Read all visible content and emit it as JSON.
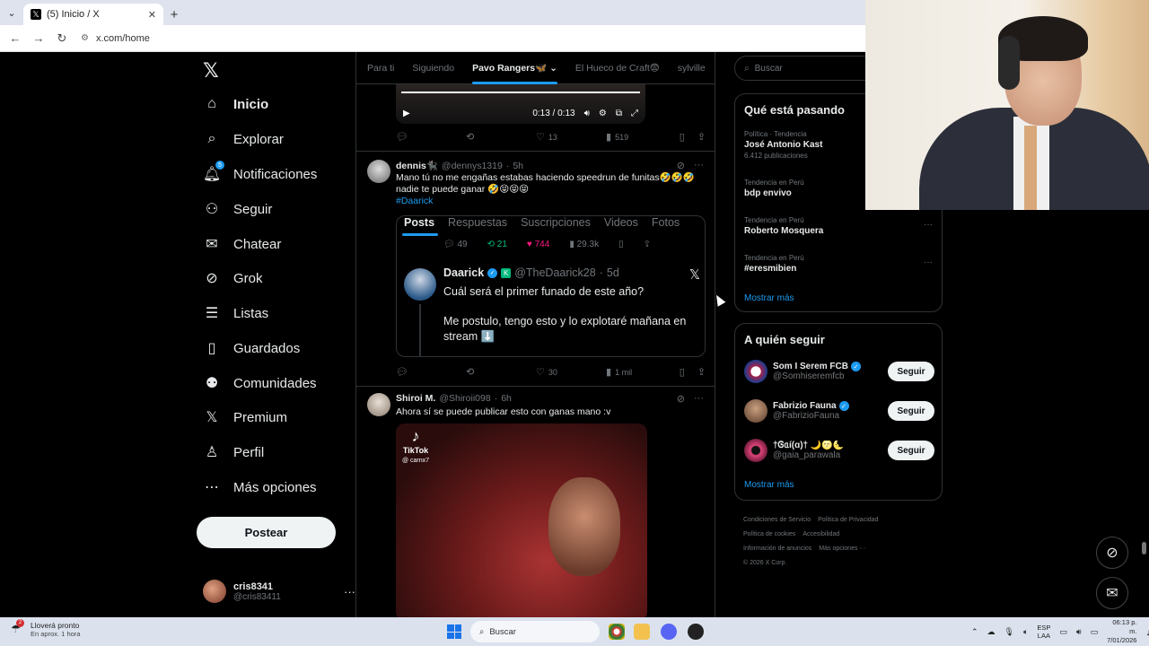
{
  "browser": {
    "tab_title": "(5) Inicio / X",
    "url": "x.com/home"
  },
  "nav": {
    "items": [
      {
        "label": "Inicio",
        "icon": "home-icon"
      },
      {
        "label": "Explorar",
        "icon": "search-icon"
      },
      {
        "label": "Notificaciones",
        "icon": "bell-icon",
        "badge": "5"
      },
      {
        "label": "Seguir",
        "icon": "add-person-icon"
      },
      {
        "label": "Chatear",
        "icon": "mail-icon"
      },
      {
        "label": "Grok",
        "icon": "grok-icon"
      },
      {
        "label": "Listas",
        "icon": "list-icon"
      },
      {
        "label": "Guardados",
        "icon": "bookmark-icon"
      },
      {
        "label": "Comunidades",
        "icon": "communities-icon"
      },
      {
        "label": "Premium",
        "icon": "x-logo-icon"
      },
      {
        "label": "Perfil",
        "icon": "person-icon"
      },
      {
        "label": "Más opciones",
        "icon": "more-circle-icon"
      }
    ],
    "post_label": "Postear",
    "account": {
      "display_name": "cris8341",
      "handle": "@cris83411"
    }
  },
  "timeline": {
    "tabs": [
      "Para ti",
      "Siguiendo",
      "Pavo Rangers🦋",
      "El Hueco de Craft😨",
      "sylville"
    ],
    "selected_tab": "Pavo Rangers🦋",
    "top_video": {
      "time": "0:13 / 0:13"
    },
    "top_actions": {
      "replies": "",
      "reposts": "",
      "likes": "13",
      "views": "519"
    },
    "tweet1": {
      "name": "dennis🐈‍⬛",
      "handle": "@dennys1319",
      "time": "5h",
      "text": "Mano tú no me engañas estabas haciendo speedrun de funitas🤣🤣🤣 nadie te puede ganar 🤣😝😝😝",
      "hashtag": "#Daarick",
      "embed": {
        "tabs": [
          "Posts",
          "Respuestas",
          "Suscripciones",
          "Videos",
          "Fotos"
        ],
        "replies": "49",
        "reposts": "21",
        "likes": "744",
        "views": "29.3k",
        "quote": {
          "name": "Daarick",
          "handle": "@TheDaarick28",
          "time": "5d",
          "line1": "Cuál será el primer funado de este año?",
          "line2": "Me postulo, tengo esto y lo explotaré mañana en stream ⬇️"
        }
      },
      "actions": {
        "replies": "",
        "reposts": "",
        "likes": "30",
        "views": "1 mil"
      }
    },
    "tweet2": {
      "name": "Shiroi M.",
      "handle": "@Shiroii098",
      "time": "6h",
      "text": "Ahora sí se puede publicar esto con ganas mano :v",
      "tiktok_label": "TikTok",
      "tiktok_user": "@ carnx7"
    }
  },
  "right": {
    "search_placeholder": "Buscar",
    "trends_title": "Qué está pasando",
    "trends": [
      {
        "context": "Política · Tendencia",
        "name": "José Antonio Kast",
        "count": "6.412 publicaciones"
      },
      {
        "context": "Tendencia en Perú",
        "name": "bdp envivo",
        "count": ""
      },
      {
        "context": "Tendencia en Perú",
        "name": "Roberto Mosquera",
        "count": ""
      },
      {
        "context": "Tendencia en Perú",
        "name": "#eresmibien",
        "count": ""
      }
    ],
    "show_more": "Mostrar más",
    "follow_title": "A quién seguir",
    "follow": [
      {
        "name": "Som I Serem FCB",
        "handle": "@Somhiseremfcb",
        "verified": true
      },
      {
        "name": "Fabrizio Fauna",
        "handle": "@FabrizioFauna",
        "verified": true
      },
      {
        "name": "†Ꮆᥲí(ɑ)† 🌙🌝🌜",
        "handle": "@gaia_parawala",
        "verified": false
      }
    ],
    "follow_button": "Seguir",
    "footer": [
      "Condiciones de Servicio",
      "Política de Privacidad",
      "Política de cookies",
      "Accesibilidad",
      "Información de anuncios",
      "Más opciones ···",
      "© 2026 X Corp."
    ]
  },
  "taskbar": {
    "weather_title": "Lloverá pronto",
    "weather_sub": "En aprox. 1 hora",
    "weather_badge": "2",
    "search": "Buscar",
    "lang1": "ESP",
    "lang2": "LAA",
    "time": "06:13 p. m.",
    "date": "7/01/2026"
  }
}
